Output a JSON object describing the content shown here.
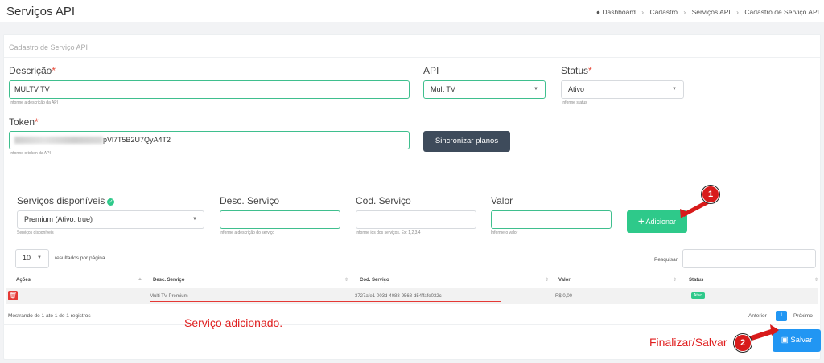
{
  "header": {
    "title": "Serviços API",
    "breadcrumb": [
      "Dashboard",
      "Cadastro",
      "Serviços API",
      "Cadastro de Serviço API"
    ]
  },
  "card": {
    "title": "Cadastro de Serviço API"
  },
  "form": {
    "descricao": {
      "label": "Descrição",
      "value": "MULTV TV",
      "help": "Informe a descrição da API"
    },
    "api": {
      "label": "API",
      "value": "Mult TV"
    },
    "status": {
      "label": "Status",
      "value": "Ativo",
      "help": "Informe status"
    },
    "token": {
      "label": "Token",
      "value_visible": "pVl7T5B2U7QyA4T2",
      "help": "Informe o token da API"
    },
    "sync_button": "Sincronizar planos"
  },
  "services": {
    "available": {
      "label": "Serviços disponíveis",
      "value": "Premium (Ativo: true)",
      "help": "Serviços disponíveis"
    },
    "desc": {
      "label": "Desc. Serviço",
      "value": "",
      "help": "Informe a descrição do serviço"
    },
    "cod": {
      "label": "Cod. Serviço",
      "value": "",
      "help": "Informe ids dos serviços. Ex: 1,2,3,4"
    },
    "valor": {
      "label": "Valor",
      "value": "",
      "help": "Informe o valor"
    },
    "add_button": "Adicionar"
  },
  "table": {
    "page_size": "10",
    "page_size_label": "resultados por página",
    "search_label": "Pesquisar",
    "columns": [
      "Ações",
      "Desc. Serviço",
      "Cod. Serviço",
      "Valor",
      "Status"
    ],
    "rows": [
      {
        "desc": "Multi TV Premium",
        "cod": "3727afe1-003d-4088-9568-d54ffafe032c",
        "valor": "R$ 0,00",
        "status": "Ativo"
      }
    ],
    "info": "Mostrando de 1 até 1 de 1 registros",
    "prev": "Anterior",
    "page": "1",
    "next": "Próximo"
  },
  "annotations": {
    "added_note": "Serviço adicionado.",
    "finalize_note": "Finalizar/Salvar",
    "marker1": "1",
    "marker2": "2"
  },
  "save_button": "Salvar",
  "colors": {
    "accent_green": "#2ec98a",
    "primary_blue": "#2196f3",
    "dark_button": "#3e4b5b",
    "annotation_red": "#e01f1f"
  }
}
